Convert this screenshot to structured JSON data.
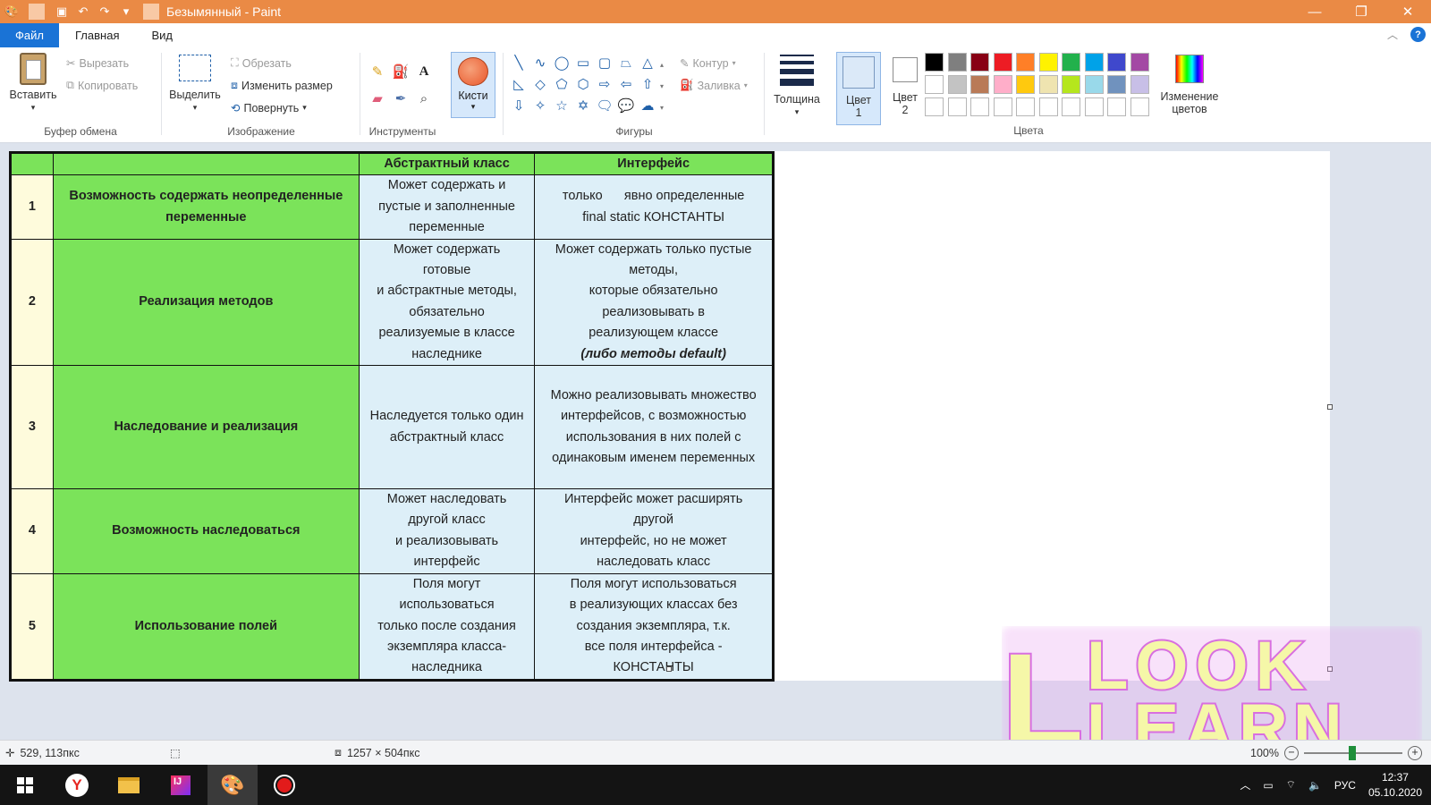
{
  "window": {
    "title": "Безымянный - Paint",
    "quick_access_icons": [
      "paint-app-icon",
      "save-icon",
      "undo-icon",
      "redo-icon",
      "customize-quick-access-icon"
    ]
  },
  "menu": {
    "file": "Файл",
    "tabs": [
      "Главная",
      "Вид"
    ]
  },
  "ribbon": {
    "clipboard": {
      "paste": "Вставить",
      "cut": "Вырезать",
      "copy": "Копировать",
      "label": "Буфер обмена"
    },
    "image": {
      "select": "Выделить",
      "crop": "Обрезать",
      "resize": "Изменить размер",
      "rotate": "Повернуть",
      "label": "Изображение"
    },
    "tools": {
      "label": "Инструменты"
    },
    "brushes": {
      "label": "Кисти"
    },
    "shapes": {
      "outline": "Контур",
      "fill": "Заливка",
      "label": "Фигуры"
    },
    "size": {
      "label": "Толщина"
    },
    "color1": {
      "label": "Цвет",
      "num": "1"
    },
    "color2": {
      "label": "Цвет",
      "num": "2"
    },
    "edit_colors": {
      "line1": "Изменение",
      "line2": "цветов"
    },
    "colors_label": "Цвета",
    "palette_row1": [
      "#000000",
      "#7f7f7f",
      "#880015",
      "#ed1c24",
      "#ff7f27",
      "#fff200",
      "#22b14c",
      "#00a2e8",
      "#3f48cc",
      "#a349a4"
    ],
    "palette_row2": [
      "#ffffff",
      "#c3c3c3",
      "#b97a57",
      "#ffaec9",
      "#ffc90e",
      "#efe4b0",
      "#b5e61d",
      "#99d9ea",
      "#7092be",
      "#c8bfe7"
    ],
    "palette_row3": [
      "#ffffff",
      "#ffffff",
      "#ffffff",
      "#ffffff",
      "#ffffff",
      "#ffffff",
      "#ffffff",
      "#ffffff",
      "#ffffff",
      "#ffffff"
    ]
  },
  "table": {
    "headers": [
      "",
      "",
      "Абстрактный класс",
      "Интерфейс"
    ],
    "rows": [
      {
        "num": "1",
        "feature": "Возможность содержать неопределенные переменные",
        "abstract": [
          "Может содержать и",
          "пустые и заполненные",
          "переменные"
        ],
        "interface": [
          "только      явно определенные",
          "final static КОНСТАНТЫ"
        ]
      },
      {
        "num": "2",
        "feature": "Реализация методов",
        "abstract": [
          "Может содержать",
          "готовые",
          "и абстрактные методы,",
          "обязательно",
          "реализуемые в классе",
          "наследнике"
        ],
        "interface": [
          "Может содержать только пустые",
          "методы,",
          "которые обязательно",
          "реализовывать в",
          "реализующем классе",
          "(либо методы default)"
        ]
      },
      {
        "num": "3",
        "feature": "Наследование и реализация",
        "abstract": [
          "Наследуется только один",
          "абстрактный класс"
        ],
        "interface": [
          "Можно реализовывать множество",
          "интерфейсов, с возможностью",
          "использования в них полей с",
          "одинаковым именем переменных"
        ]
      },
      {
        "num": "4",
        "feature": "Возможность наследоваться",
        "abstract": [
          "Может наследовать",
          "другой класс",
          "и реализовывать",
          "интерфейс"
        ],
        "interface": [
          "Интерфейс может расширять",
          "другой",
          "интерфейс, но не может",
          "наследовать класс"
        ]
      },
      {
        "num": "5",
        "feature": "Использование полей",
        "abstract": [
          "Поля могут",
          "использоваться",
          "только после создания",
          "экземпляра класса-",
          "наследника"
        ],
        "interface": [
          "Поля могут использоваться",
          "в реализующих классах без",
          "создания экземпляра, т.к.",
          "все поля интерфейса -",
          "КОНСТАНТЫ"
        ]
      }
    ]
  },
  "watermark": {
    "line1": "LOOK",
    "line2": "LEARN"
  },
  "status": {
    "cursor_pos": "529, 113пкс",
    "image_size": "1257 × 504пкс",
    "zoom": "100%"
  },
  "taskbar": {
    "apps": [
      "windows-start-icon",
      "yandex-browser-icon",
      "file-explorer-icon",
      "intellij-idea-icon",
      "paint-icon",
      "recorder-icon"
    ],
    "lang": "РУС",
    "time": "12:37",
    "date": "05.10.2020"
  }
}
